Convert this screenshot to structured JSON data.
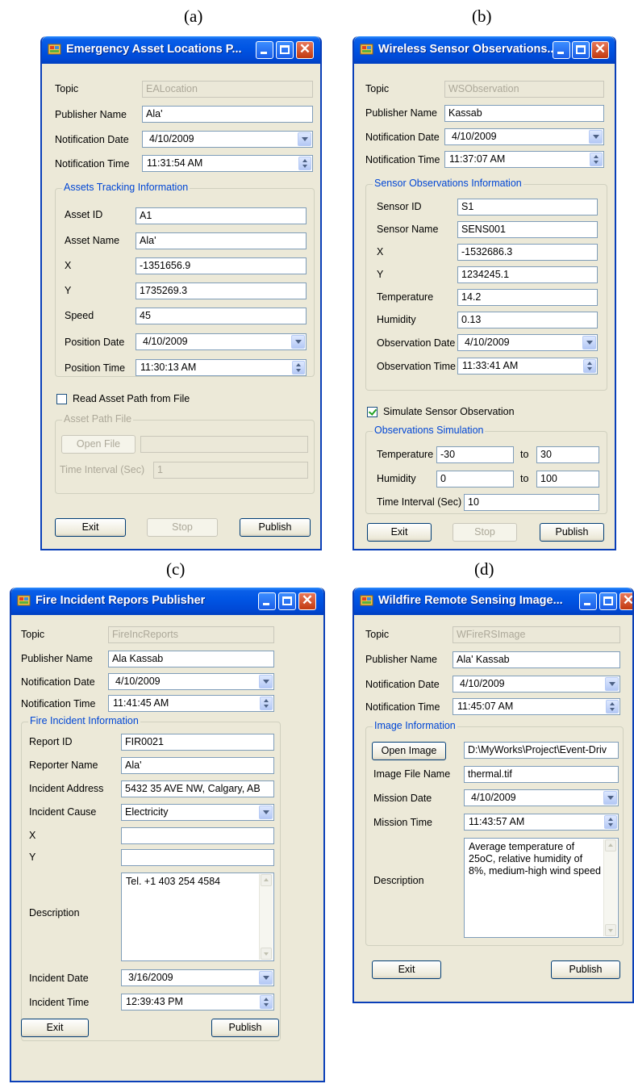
{
  "captions": {
    "a": "(a)",
    "b": "(b)",
    "c": "(c)",
    "d": "(d)"
  },
  "common": {
    "exit": "Exit",
    "stop": "Stop",
    "publish": "Publish"
  },
  "a": {
    "title": "Emergency Asset Locations P...",
    "topic_label": "Topic",
    "topic_value": "EALocation",
    "publisher_label": "Publisher Name",
    "publisher_value": "Ala'",
    "ndate_label": "Notification Date",
    "ndate_value": "4/10/2009",
    "ntime_label": "Notification Time",
    "ntime_value": "11:31:54 AM",
    "group_title": "Assets Tracking Information",
    "asset_id_label": "Asset ID",
    "asset_id_value": "A1",
    "asset_name_label": "Asset Name",
    "asset_name_value": "Ala'",
    "x_label": "X",
    "x_value": "-1351656.9",
    "y_label": "Y",
    "y_value": "1735269.3",
    "speed_label": "Speed",
    "speed_value": "45",
    "pdate_label": "Position Date",
    "pdate_value": "4/10/2009",
    "ptime_label": "Position Time",
    "ptime_value": "11:30:13 AM",
    "read_path_label": "Read Asset Path from File",
    "path_group_title": "Asset Path File",
    "open_file": "Open File",
    "interval_label": "Time Interval (Sec)",
    "interval_value": "1"
  },
  "b": {
    "title": "Wireless Sensor Observations...",
    "topic_label": "Topic",
    "topic_value": "WSObservation",
    "publisher_label": "Publisher Name",
    "publisher_value": "Kassab",
    "ndate_label": "Notification Date",
    "ndate_value": "4/10/2009",
    "ntime_label": "Notification Time",
    "ntime_value": "11:37:07 AM",
    "group_title": "Sensor Observations Information",
    "sensor_id_label": "Sensor ID",
    "sensor_id_value": "S1",
    "sensor_name_label": "Sensor Name",
    "sensor_name_value": "SENS001",
    "x_label": "X",
    "x_value": "-1532686.3",
    "y_label": "Y",
    "y_value": "1234245.1",
    "temp_label": "Temperature",
    "temp_value": "14.2",
    "hum_label": "Humidity",
    "hum_value": "0.13",
    "odate_label": "Observation Date",
    "odate_value": "4/10/2009",
    "otime_label": "Observation Time",
    "otime_value": "11:33:41 AM",
    "simulate_label": "Simulate Sensor Observation",
    "sim_group_title": "Observations Simulation",
    "sim_temp_label": "Temperature",
    "sim_temp_from": "-30",
    "sim_temp_to": "30",
    "sim_hum_label": "Humidity",
    "sim_hum_from": "0",
    "sim_hum_to": "100",
    "to_label": "to",
    "sim_interval_label": "Time Interval (Sec)",
    "sim_interval_value": "10"
  },
  "c": {
    "title": "Fire Incident Repors Publisher",
    "topic_label": "Topic",
    "topic_value": "FireIncReports",
    "publisher_label": "Publisher Name",
    "publisher_value": "Ala Kassab",
    "ndate_label": "Notification Date",
    "ndate_value": "4/10/2009",
    "ntime_label": "Notification Time",
    "ntime_value": "11:41:45 AM",
    "group_title": "Fire Incident Information",
    "report_id_label": "Report ID",
    "report_id_value": "FIR0021",
    "reporter_label": "Reporter Name",
    "reporter_value": "Ala'",
    "address_label": "Incident Address",
    "address_value": "5432 35 AVE NW, Calgary, AB",
    "cause_label": "Incident Cause",
    "cause_value": "Electricity",
    "x_label": "X",
    "x_value": "",
    "y_label": "Y",
    "y_value": "",
    "desc_label": "Description",
    "desc_value": "Tel. +1 403 254 4584",
    "idate_label": "Incident Date",
    "idate_value": "3/16/2009",
    "itime_label": "Incident Time",
    "itime_value": "12:39:43 PM"
  },
  "d": {
    "title": "Wildfire Remote Sensing Image...",
    "topic_label": "Topic",
    "topic_value": "WFireRSImage",
    "publisher_label": "Publisher Name",
    "publisher_value": "Ala' Kassab",
    "ndate_label": "Notification Date",
    "ndate_value": "4/10/2009",
    "ntime_label": "Notification Time",
    "ntime_value": "11:45:07 AM",
    "group_title": "Image Information",
    "open_image": "Open Image",
    "image_path_value": "D:\\MyWorks\\Project\\Event-Driv",
    "file_name_label": "Image File Name",
    "file_name_value": "thermal.tif",
    "mdate_label": "Mission Date",
    "mdate_value": "4/10/2009",
    "mtime_label": "Mission Time",
    "mtime_value": "11:43:57 AM",
    "desc_label": "Description",
    "desc_value": "Average temperature of 25oC, relative humidity of 8%, medium-high wind speed"
  }
}
